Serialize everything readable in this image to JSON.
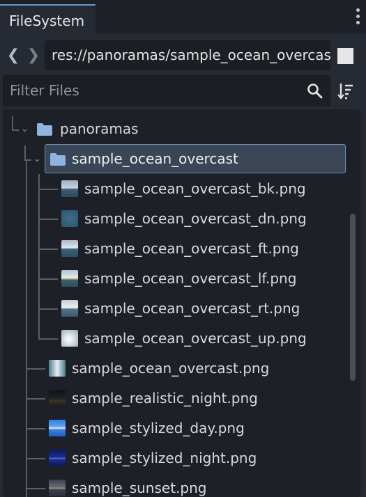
{
  "tab": {
    "title": "FileSystem"
  },
  "path": {
    "value": "res://panoramas/sample_ocean_overcast"
  },
  "filter": {
    "placeholder": "Filter Files"
  },
  "tree": {
    "root_folder": "panoramas",
    "selected_folder": "sample_ocean_overcast",
    "child_files": [
      "sample_ocean_overcast_bk.png",
      "sample_ocean_overcast_dn.png",
      "sample_ocean_overcast_ft.png",
      "sample_ocean_overcast_lf.png",
      "sample_ocean_overcast_rt.png",
      "sample_ocean_overcast_up.png"
    ],
    "sibling_files": [
      "sample_ocean_overcast.png",
      "sample_realistic_night.png",
      "sample_stylized_day.png",
      "sample_stylized_night.png",
      "sample_sunset.png"
    ]
  },
  "colors": {
    "accent": "#6f95c9",
    "folder": "#8fb4df",
    "selection": "#3a4655"
  }
}
